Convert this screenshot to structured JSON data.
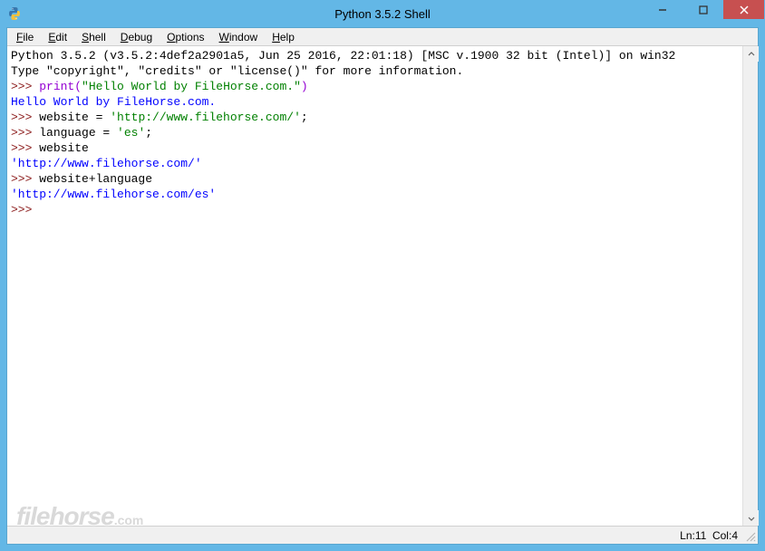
{
  "window": {
    "title": "Python 3.5.2 Shell"
  },
  "menu": {
    "items": [
      {
        "label": "File",
        "accel": "F"
      },
      {
        "label": "Edit",
        "accel": "E"
      },
      {
        "label": "Shell",
        "accel": "S"
      },
      {
        "label": "Debug",
        "accel": "D"
      },
      {
        "label": "Options",
        "accel": "O"
      },
      {
        "label": "Window",
        "accel": "W"
      },
      {
        "label": "Help",
        "accel": "H"
      }
    ]
  },
  "shell": {
    "banner_line1": "Python 3.5.2 (v3.5.2:4def2a2901a5, Jun 25 2016, 22:01:18) [MSC v.1900 32 bit (Intel)] on win32",
    "banner_line2": "Type \"copyright\", \"credits\" or \"license()\" for more information.",
    "prompt": ">>> ",
    "entries": [
      {
        "input": {
          "call": "print",
          "paren_open": "(",
          "string": "\"Hello World by FileHorse.com.\"",
          "paren_close": ")"
        },
        "output": {
          "text": "Hello World by FileHorse.com.",
          "type": "stdout"
        }
      },
      {
        "input_plain": "website = ",
        "input_string": "'http://www.filehorse.com/'",
        "input_tail": ";"
      },
      {
        "input_plain": "language = ",
        "input_string": "'es'",
        "input_tail": ";"
      },
      {
        "input_plain": "website",
        "output": {
          "text": "'http://www.filehorse.com/'",
          "type": "repr"
        }
      },
      {
        "input_plain": "website+language",
        "output": {
          "text": "'http://www.filehorse.com/es'",
          "type": "repr"
        }
      }
    ],
    "last_prompt": ">>> "
  },
  "status": {
    "line": "11",
    "col": "4",
    "ln_label": "Ln: ",
    "col_label": "Col: "
  },
  "watermark": {
    "name": "filehorse",
    "domain": ".com"
  }
}
